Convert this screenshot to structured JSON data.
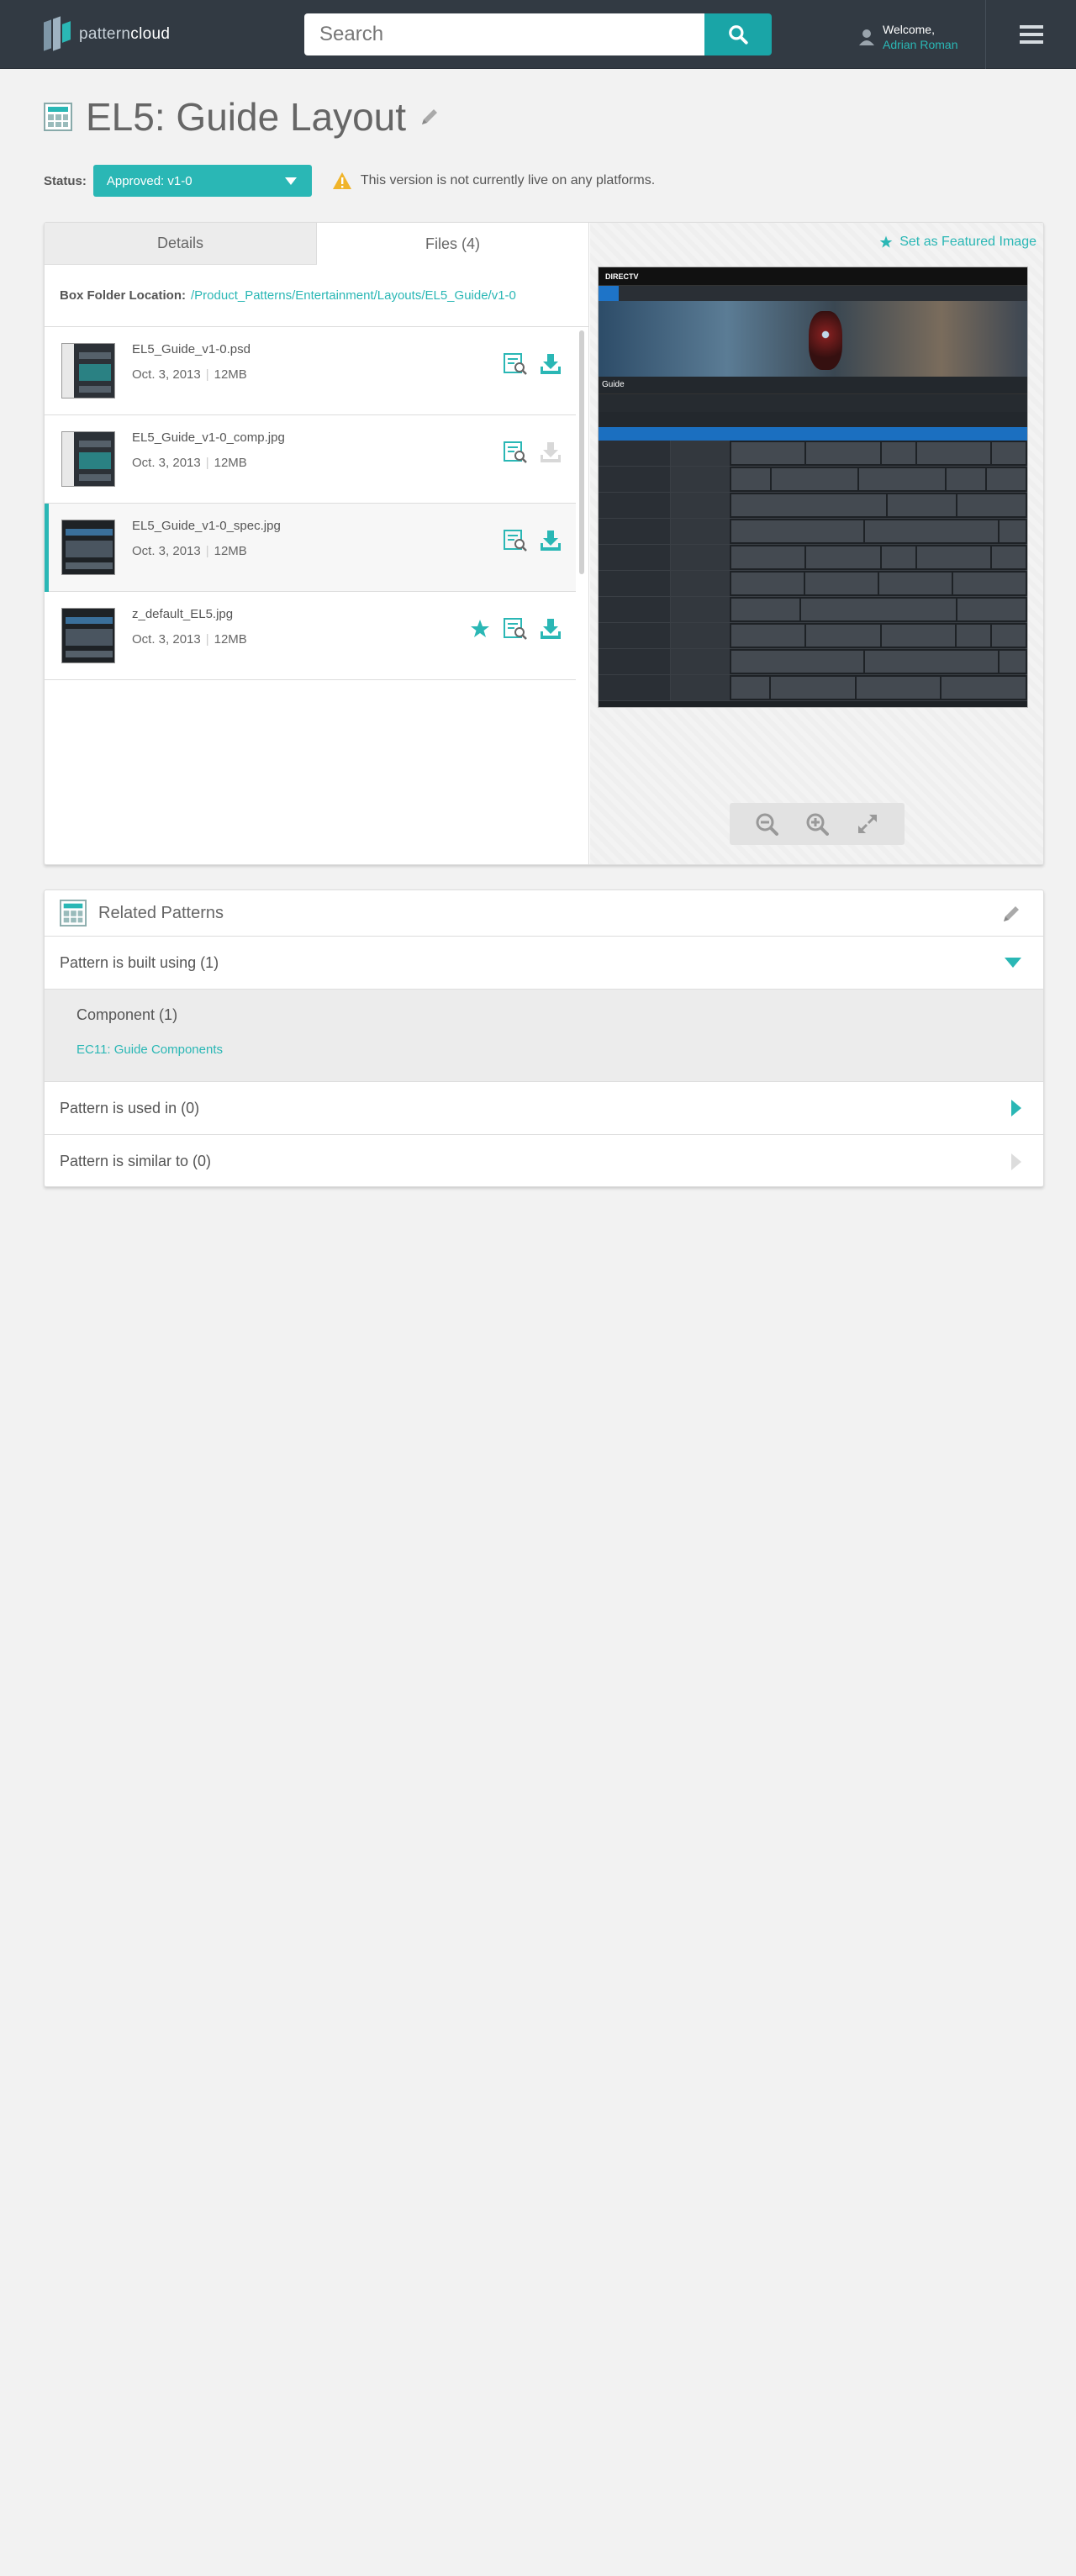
{
  "header": {
    "logo_prefix": "pattern",
    "logo_suffix": "cloud",
    "search_placeholder": "Search",
    "welcome": "Welcome,",
    "user_name": "Adrian Roman"
  },
  "page": {
    "title": "EL5: Guide Layout",
    "status_label": "Status:",
    "status_value": "Approved:  v1-0",
    "warning_text": "This version is not currently live on any platforms."
  },
  "tabs": [
    {
      "label": "Details",
      "active": false
    },
    {
      "label": "Files (4)",
      "active": true
    }
  ],
  "folder": {
    "label": "Box Folder Location:",
    "path": "/Product_Patterns/Entertainment/Layouts/EL5_Guide/v1-0"
  },
  "files": [
    {
      "name": "EL5_Guide_v1-0.psd",
      "date": "Oct. 3, 2013",
      "size": "12MB",
      "selected": false,
      "featured": false,
      "download_enabled": true
    },
    {
      "name": "EL5_Guide_v1-0_comp.jpg",
      "date": "Oct. 3, 2013",
      "size": "12MB",
      "selected": false,
      "featured": false,
      "download_enabled": false
    },
    {
      "name": "EL5_Guide_v1-0_spec.jpg",
      "date": "Oct. 3, 2013",
      "size": "12MB",
      "selected": true,
      "featured": false,
      "download_enabled": true
    },
    {
      "name": "z_default_EL5.jpg",
      "date": "Oct. 3, 2013",
      "size": "12MB",
      "selected": false,
      "featured": true,
      "download_enabled": true
    }
  ],
  "preview": {
    "set_featured": "Set as Featured Image",
    "brand": "DIRECTV",
    "guide_label": "Guide"
  },
  "related": {
    "title": "Related Patterns",
    "built_using": "Pattern is built using (1)",
    "component_heading": "Component (1)",
    "component_link": "EC11: Guide Components",
    "used_in": "Pattern is used in (0)",
    "similar_to": "Pattern is similar to (0)"
  },
  "colors": {
    "accent": "#2ab7b5",
    "header_bg": "#323a43",
    "warning": "#f0b429"
  }
}
